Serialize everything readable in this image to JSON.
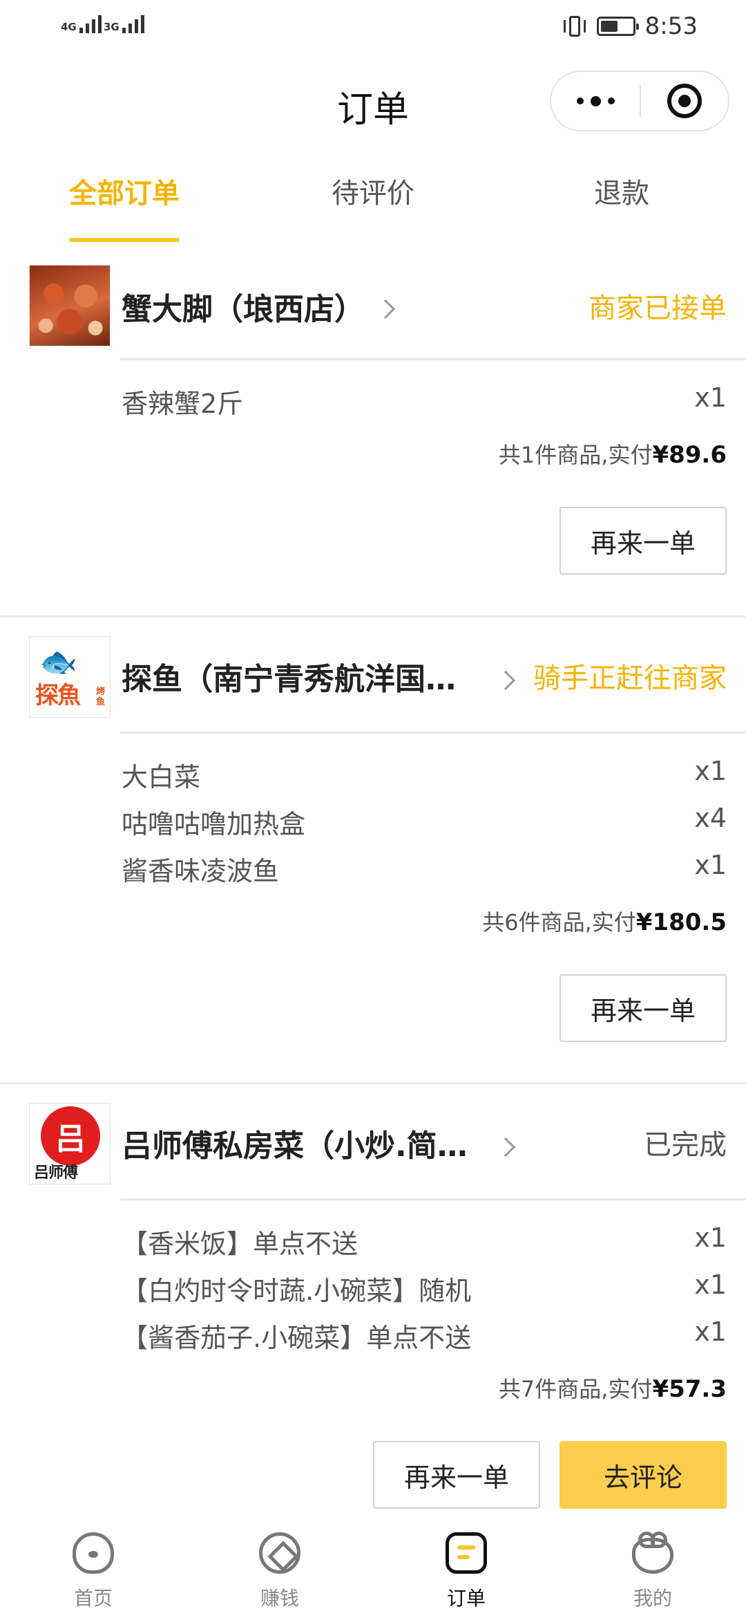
{
  "status_bar": {
    "signal_1": "4G",
    "signal_2": "3G",
    "time": "8:53"
  },
  "header": {
    "title": "订单",
    "more_icon": "more-dots-icon",
    "close_icon": "target-close-icon"
  },
  "tabs": [
    {
      "label": "全部订单",
      "active": true
    },
    {
      "label": "待评价",
      "active": false
    },
    {
      "label": "退款",
      "active": false
    }
  ],
  "orders": [
    {
      "shop_name": "蟹大脚（埌西店）",
      "status": "商家已接单",
      "items": [
        {
          "name": "香辣蟹2斤",
          "qty": "x1"
        }
      ],
      "summary_prefix": "共1件商品,实付",
      "price": "¥89.6",
      "buttons": [
        "再来一单"
      ]
    },
    {
      "shop_name": "探鱼（南宁青秀航洋国…",
      "status": "骑手正赶往商家",
      "logo_text": "探魚",
      "logo_small": "烤鱼",
      "items": [
        {
          "name": "大白菜",
          "qty": "x1"
        },
        {
          "name": "咕噜咕噜加热盒",
          "qty": "x4"
        },
        {
          "name": "酱香味凌波鱼",
          "qty": "x1"
        }
      ],
      "summary_prefix": "共6件商品,实付",
      "price": "¥180.5",
      "buttons": [
        "再来一单"
      ]
    },
    {
      "shop_name": "吕师傅私房菜（小炒.简…",
      "status": "已完成",
      "logo_text": "吕师傅",
      "logo_symbol": "吕",
      "items": [
        {
          "name": "【香米饭】单点不送",
          "qty": "x1"
        },
        {
          "name": "【白灼时令时蔬.小碗菜】随机",
          "qty": "x1"
        },
        {
          "name": "【酱香茄子.小碗菜】单点不送",
          "qty": "x1"
        }
      ],
      "summary_prefix": "共7件商品,实付",
      "price": "¥57.3",
      "buttons": [
        "再来一单",
        "去评论"
      ]
    }
  ],
  "bottom_nav": [
    {
      "label": "首页",
      "icon": "home-icon",
      "active": false
    },
    {
      "label": "赚钱",
      "icon": "earn-icon",
      "active": false
    },
    {
      "label": "订单",
      "icon": "order-icon",
      "active": true
    },
    {
      "label": "我的",
      "icon": "mine-icon",
      "active": false
    }
  ],
  "colors": {
    "accent": "#f5b400",
    "primary_button": "#fdcd4d",
    "divider": "#e9e9e9"
  }
}
